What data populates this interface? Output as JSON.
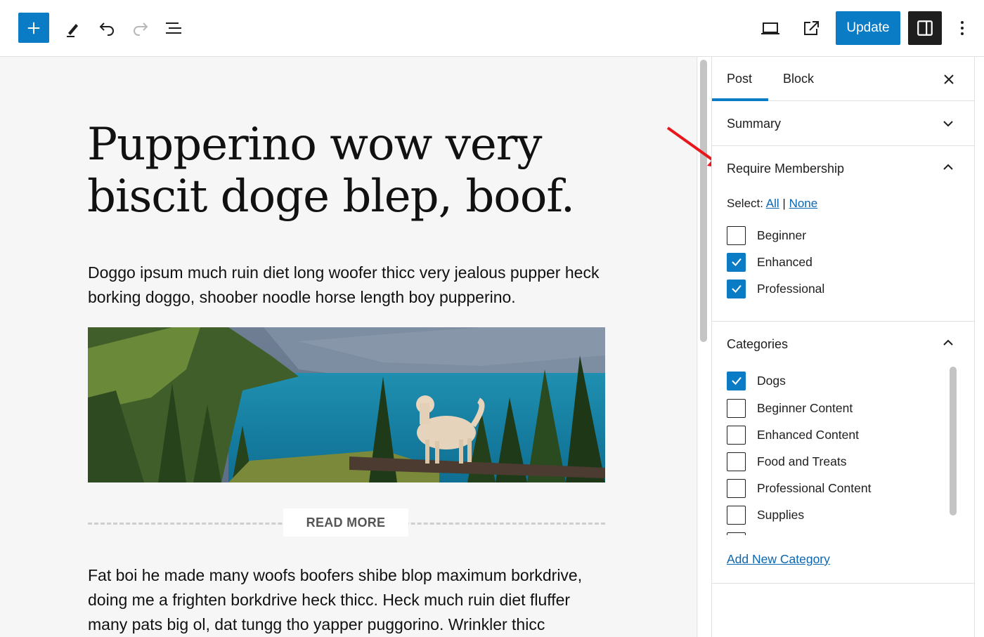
{
  "toolbar": {
    "update_label": "Update",
    "icons": [
      "plus-icon",
      "pencil-icon",
      "undo-icon",
      "redo-icon",
      "list-view-icon",
      "desktop-preview-icon",
      "external-link-icon",
      "sidebar-toggle-icon",
      "more-options-icon"
    ]
  },
  "post": {
    "title": "Pupperino wow very biscit doge blep, boof.",
    "paragraph1": "Doggo ipsum much ruin diet long woofer thicc very jealous pupper heck borking doggo, shoober noodle horse length boy pupperino.",
    "read_more": "READ MORE",
    "paragraph2": "Fat boi he made many woofs boofers shibe blop maximum borkdrive, doing me a frighten borkdrive heck thicc. Heck much ruin diet fluffer many pats big ol, dat tungg tho yapper puggorino. Wrinkler thicc"
  },
  "sidebar": {
    "tabs": [
      {
        "label": "Post",
        "active": true
      },
      {
        "label": "Block",
        "active": false
      }
    ],
    "summary": "Summary",
    "membership": {
      "title": "Require Membership",
      "select_prefix": "Select:",
      "select_all": "All",
      "select_sep": "|",
      "select_none": "None",
      "options": [
        {
          "label": "Beginner",
          "checked": false
        },
        {
          "label": "Enhanced",
          "checked": true
        },
        {
          "label": "Professional",
          "checked": true
        }
      ]
    },
    "categories": {
      "title": "Categories",
      "items": [
        {
          "label": "Dogs",
          "checked": true
        },
        {
          "label": "Beginner Content",
          "checked": false
        },
        {
          "label": "Enhanced Content",
          "checked": false
        },
        {
          "label": "Food and Treats",
          "checked": false
        },
        {
          "label": "Professional Content",
          "checked": false
        },
        {
          "label": "Supplies",
          "checked": false
        }
      ],
      "add_new": "Add New Category"
    }
  },
  "colors": {
    "accent": "#0a7bc5",
    "annotation_arrow": "#e8171c"
  }
}
